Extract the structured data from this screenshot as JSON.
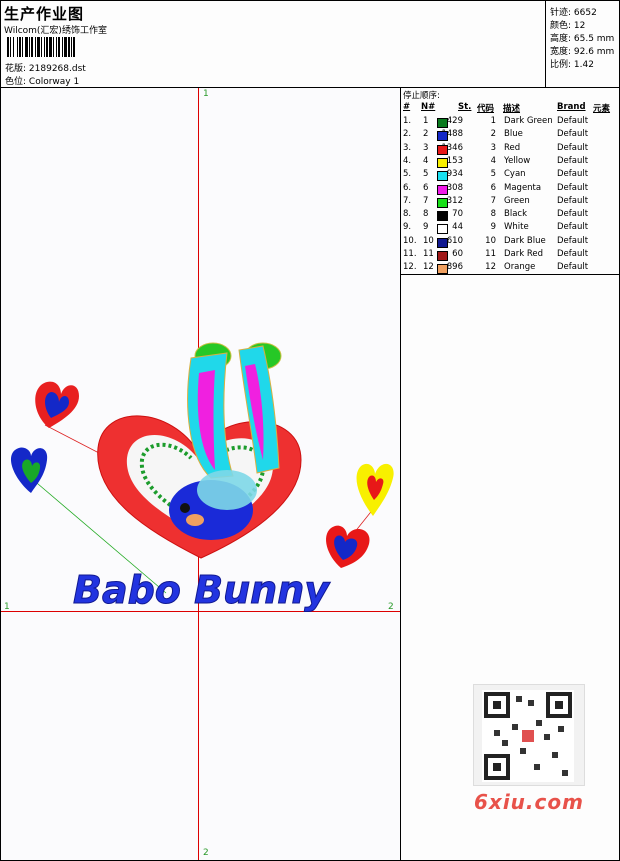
{
  "header": {
    "title": "生产作业图",
    "company": "Wilcom(汇宏)绣饰工作室",
    "design_label": "花版:",
    "design_value": "2189268.dst",
    "colorway_label": "色位:",
    "colorway_value": "Colorway 1"
  },
  "stats": {
    "stitches": "针迹: 6652",
    "colors": "颜色: 12",
    "height": "高度: 65.5 mm",
    "width": "宽度: 92.6 mm",
    "ratio": "比例: 1.42"
  },
  "axes": {
    "top": "1",
    "bottom": "2",
    "left": "1",
    "right": "2"
  },
  "stop_table": {
    "title": "停止顺序:",
    "headers": [
      "#",
      "N#",
      "St.",
      "代码",
      "描述",
      "Brand",
      "元素"
    ],
    "rows": [
      {
        "idx": "1.",
        "n": "1",
        "st": "429",
        "code": "1",
        "desc": "Dark Green",
        "brand": "Default",
        "color": "#0a7a1e"
      },
      {
        "idx": "2.",
        "n": "2",
        "st": "1488",
        "code": "2",
        "desc": "Blue",
        "brand": "Default",
        "color": "#1428c8"
      },
      {
        "idx": "3.",
        "n": "3",
        "st": "1346",
        "code": "3",
        "desc": "Red",
        "brand": "Default",
        "color": "#e81818"
      },
      {
        "idx": "4.",
        "n": "4",
        "st": "153",
        "code": "4",
        "desc": "Yellow",
        "brand": "Default",
        "color": "#f8f000"
      },
      {
        "idx": "5.",
        "n": "5",
        "st": "934",
        "code": "5",
        "desc": "Cyan",
        "brand": "Default",
        "color": "#18e0f0"
      },
      {
        "idx": "6.",
        "n": "6",
        "st": "308",
        "code": "6",
        "desc": "Magenta",
        "brand": "Default",
        "color": "#f018e8"
      },
      {
        "idx": "7.",
        "n": "7",
        "st": "312",
        "code": "7",
        "desc": "Green",
        "brand": "Default",
        "color": "#18e018"
      },
      {
        "idx": "8.",
        "n": "8",
        "st": "70",
        "code": "8",
        "desc": "Black",
        "brand": "Default",
        "color": "#000000"
      },
      {
        "idx": "9.",
        "n": "9",
        "st": "44",
        "code": "9",
        "desc": "White",
        "brand": "Default",
        "color": "#ffffff"
      },
      {
        "idx": "10.",
        "n": "10",
        "st": "610",
        "code": "10",
        "desc": "Dark Blue",
        "brand": "Default",
        "color": "#101890"
      },
      {
        "idx": "11.",
        "n": "11",
        "st": "60",
        "code": "11",
        "desc": "Dark Red",
        "brand": "Default",
        "color": "#a01818"
      },
      {
        "idx": "12.",
        "n": "12",
        "st": "896",
        "code": "12",
        "desc": "Orange",
        "brand": "Default",
        "color": "#f0a060"
      }
    ]
  },
  "design_text": "Babo Bunny",
  "watermark": "6xiu.com"
}
